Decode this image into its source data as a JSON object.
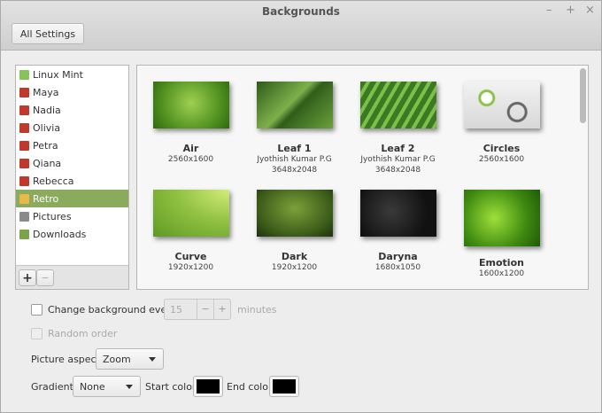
{
  "window": {
    "title": "Backgrounds",
    "controls": [
      "–",
      "+",
      "×"
    ]
  },
  "toolbar": {
    "all_settings": "All Settings"
  },
  "sidebar": {
    "items": [
      {
        "label": "Linux Mint",
        "icon": "mint-logo-icon",
        "color": "#87c25a"
      },
      {
        "label": "Maya",
        "icon": "collection-icon",
        "color": "#c0392b"
      },
      {
        "label": "Nadia",
        "icon": "collection-icon",
        "color": "#c0392b"
      },
      {
        "label": "Olivia",
        "icon": "collection-icon",
        "color": "#c0392b"
      },
      {
        "label": "Petra",
        "icon": "collection-icon",
        "color": "#c0392b"
      },
      {
        "label": "Qiana",
        "icon": "collection-icon",
        "color": "#c0392b"
      },
      {
        "label": "Rebecca",
        "icon": "collection-icon",
        "color": "#c0392b"
      },
      {
        "label": "Retro",
        "icon": "retro-icon",
        "color": "#e8b84a",
        "selected": true
      },
      {
        "label": "Pictures",
        "icon": "pictures-folder-icon",
        "color": "#8a8a8a"
      },
      {
        "label": "Downloads",
        "icon": "downloads-folder-icon",
        "color": "#7aa34a"
      }
    ],
    "add": "+",
    "remove": "−"
  },
  "wallpapers": [
    {
      "name": "Air",
      "author": "",
      "size": "2560x1600"
    },
    {
      "name": "Leaf 1",
      "author": "Jyothish Kumar P.G",
      "size": "3648x2048"
    },
    {
      "name": "Leaf 2",
      "author": "Jyothish Kumar P.G",
      "size": "3648x2048"
    },
    {
      "name": "Circles",
      "author": "",
      "size": "2560x1600"
    },
    {
      "name": "Curve",
      "author": "",
      "size": "1920x1200"
    },
    {
      "name": "Dark",
      "author": "",
      "size": "1920x1200"
    },
    {
      "name": "Daryna",
      "author": "",
      "size": "1680x1050"
    },
    {
      "name": "Emotion",
      "author": "",
      "size": "1600x1200"
    }
  ],
  "settings": {
    "change_every_label": "Change background every",
    "interval": "15",
    "minus": "−",
    "plus": "+",
    "minutes": "minutes",
    "random_order": "Random order",
    "picture_aspect_label": "Picture aspect",
    "picture_aspect": "Zoom",
    "gradient_label": "Gradient",
    "gradient": "None",
    "start_color_label": "Start color",
    "start_color": "#000000",
    "end_color_label": "End color",
    "end_color": "#000000"
  },
  "accent": "#8aab5e"
}
